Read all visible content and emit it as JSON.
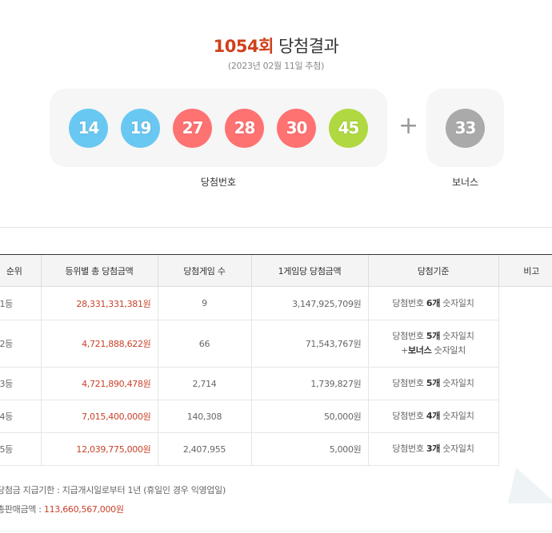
{
  "header": {
    "round": "1054회",
    "title": "당첨결과",
    "draw_date": "(2023년 02월 11일 추첨)"
  },
  "winning": {
    "numbers": [
      {
        "value": "14",
        "color": "#69c8f2"
      },
      {
        "value": "19",
        "color": "#69c8f2"
      },
      {
        "value": "27",
        "color": "#ff7272"
      },
      {
        "value": "28",
        "color": "#ff7272"
      },
      {
        "value": "30",
        "color": "#ff7272"
      },
      {
        "value": "45",
        "color": "#b0d840"
      }
    ],
    "plus": "+",
    "label": "당첨번호"
  },
  "bonus": {
    "value": "33",
    "color": "#aaaaaa",
    "label": "보너스"
  },
  "table": {
    "headers": [
      "순위",
      "등위별 총 당첨금액",
      "당첨게임 수",
      "1게임당 당첨금액",
      "당첨기준",
      "비고"
    ],
    "rows": [
      {
        "rank": "1등",
        "total": "28,331,331,381원",
        "count": "9",
        "per_game": "3,147,925,709원",
        "crit_a": "당첨번호 ",
        "crit_b": "6개",
        "crit_c": " 숫자일치",
        "crit2_a": "",
        "crit2_b": "",
        "crit2_c": ""
      },
      {
        "rank": "2등",
        "total": "4,721,888,622원",
        "count": "66",
        "per_game": "71,543,767원",
        "crit_a": "당첨번호 ",
        "crit_b": "5개",
        "crit_c": " 숫자일치",
        "crit2_a": "+",
        "crit2_b": "보너스",
        "crit2_c": " 숫자일치"
      },
      {
        "rank": "3등",
        "total": "4,721,890,478원",
        "count": "2,714",
        "per_game": "1,739,827원",
        "crit_a": "당첨번호 ",
        "crit_b": "5개",
        "crit_c": " 숫자일치",
        "crit2_a": "",
        "crit2_b": "",
        "crit2_c": ""
      },
      {
        "rank": "4등",
        "total": "7,015,400,000원",
        "count": "140,308",
        "per_game": "50,000원",
        "crit_a": "당첨번호 ",
        "crit_b": "4개",
        "crit_c": " 숫자일치",
        "crit2_a": "",
        "crit2_b": "",
        "crit2_c": ""
      },
      {
        "rank": "5등",
        "total": "12,039,775,000원",
        "count": "2,407,955",
        "per_game": "5,000원",
        "crit_a": "당첨번호 ",
        "crit_b": "3개",
        "crit_c": " 숫자일치",
        "crit2_a": "",
        "crit2_b": "",
        "crit2_c": ""
      }
    ]
  },
  "footer": {
    "deadline": "당첨금 지급기한 : 지급개시일로부터 1년 (휴일인 경우 익영업일)",
    "sales_label": "총판매금액 : ",
    "sales_amount": "113,660,567,000원"
  }
}
